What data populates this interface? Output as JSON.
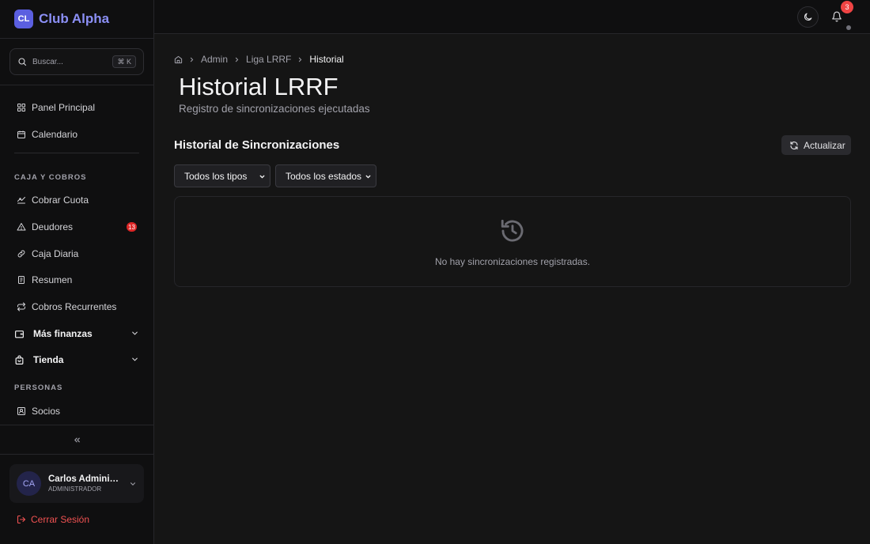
{
  "brand": {
    "logo_text": "CL",
    "name": "Club Alpha"
  },
  "search": {
    "placeholder": "Buscar...",
    "shortcut": "⌘ K"
  },
  "nav": {
    "main": [
      {
        "label": "Panel Principal",
        "icon": "grid-icon"
      },
      {
        "label": "Calendario",
        "icon": "calendar-icon"
      }
    ],
    "section_caja": "CAJA Y COBROS",
    "caja": [
      {
        "label": "Cobrar Cuota",
        "icon": "money-icon"
      },
      {
        "label": "Deudores",
        "icon": "warning-icon",
        "badge": "13"
      },
      {
        "label": "Caja Diaria",
        "icon": "link-icon"
      },
      {
        "label": "Resumen",
        "icon": "receipt-icon"
      },
      {
        "label": "Cobros Recurrentes",
        "icon": "repeat-icon"
      }
    ],
    "groups": [
      {
        "label": "Más finanzas",
        "icon": "wallet-icon"
      },
      {
        "label": "Tienda",
        "icon": "bag-icon"
      }
    ],
    "section_personas": "PERSONAS",
    "personas": [
      {
        "label": "Socios",
        "icon": "id-card-icon"
      }
    ]
  },
  "user": {
    "initials": "CA",
    "name": "Carlos Administrador",
    "role": "ADMINISTRADOR"
  },
  "logout_label": "Cerrar Sesión",
  "topbar": {
    "notification_count": "3"
  },
  "breadcrumb": {
    "items": [
      "Admin",
      "Liga LRRF"
    ],
    "current": "Historial"
  },
  "page": {
    "title": "Historial LRRF",
    "subtitle": "Registro de sincronizaciones ejecutadas",
    "section_title": "Historial de Sincronizaciones",
    "refresh_label": "Actualizar"
  },
  "filters": {
    "type_selected": "Todos los tipos",
    "status_selected": "Todos los estados"
  },
  "empty_state": {
    "message": "No hay sincronizaciones registradas."
  },
  "colors": {
    "accent": "#5b5fe0",
    "danger": "#ef4444",
    "background": "#151515",
    "sidebar": "#0f0f10"
  }
}
